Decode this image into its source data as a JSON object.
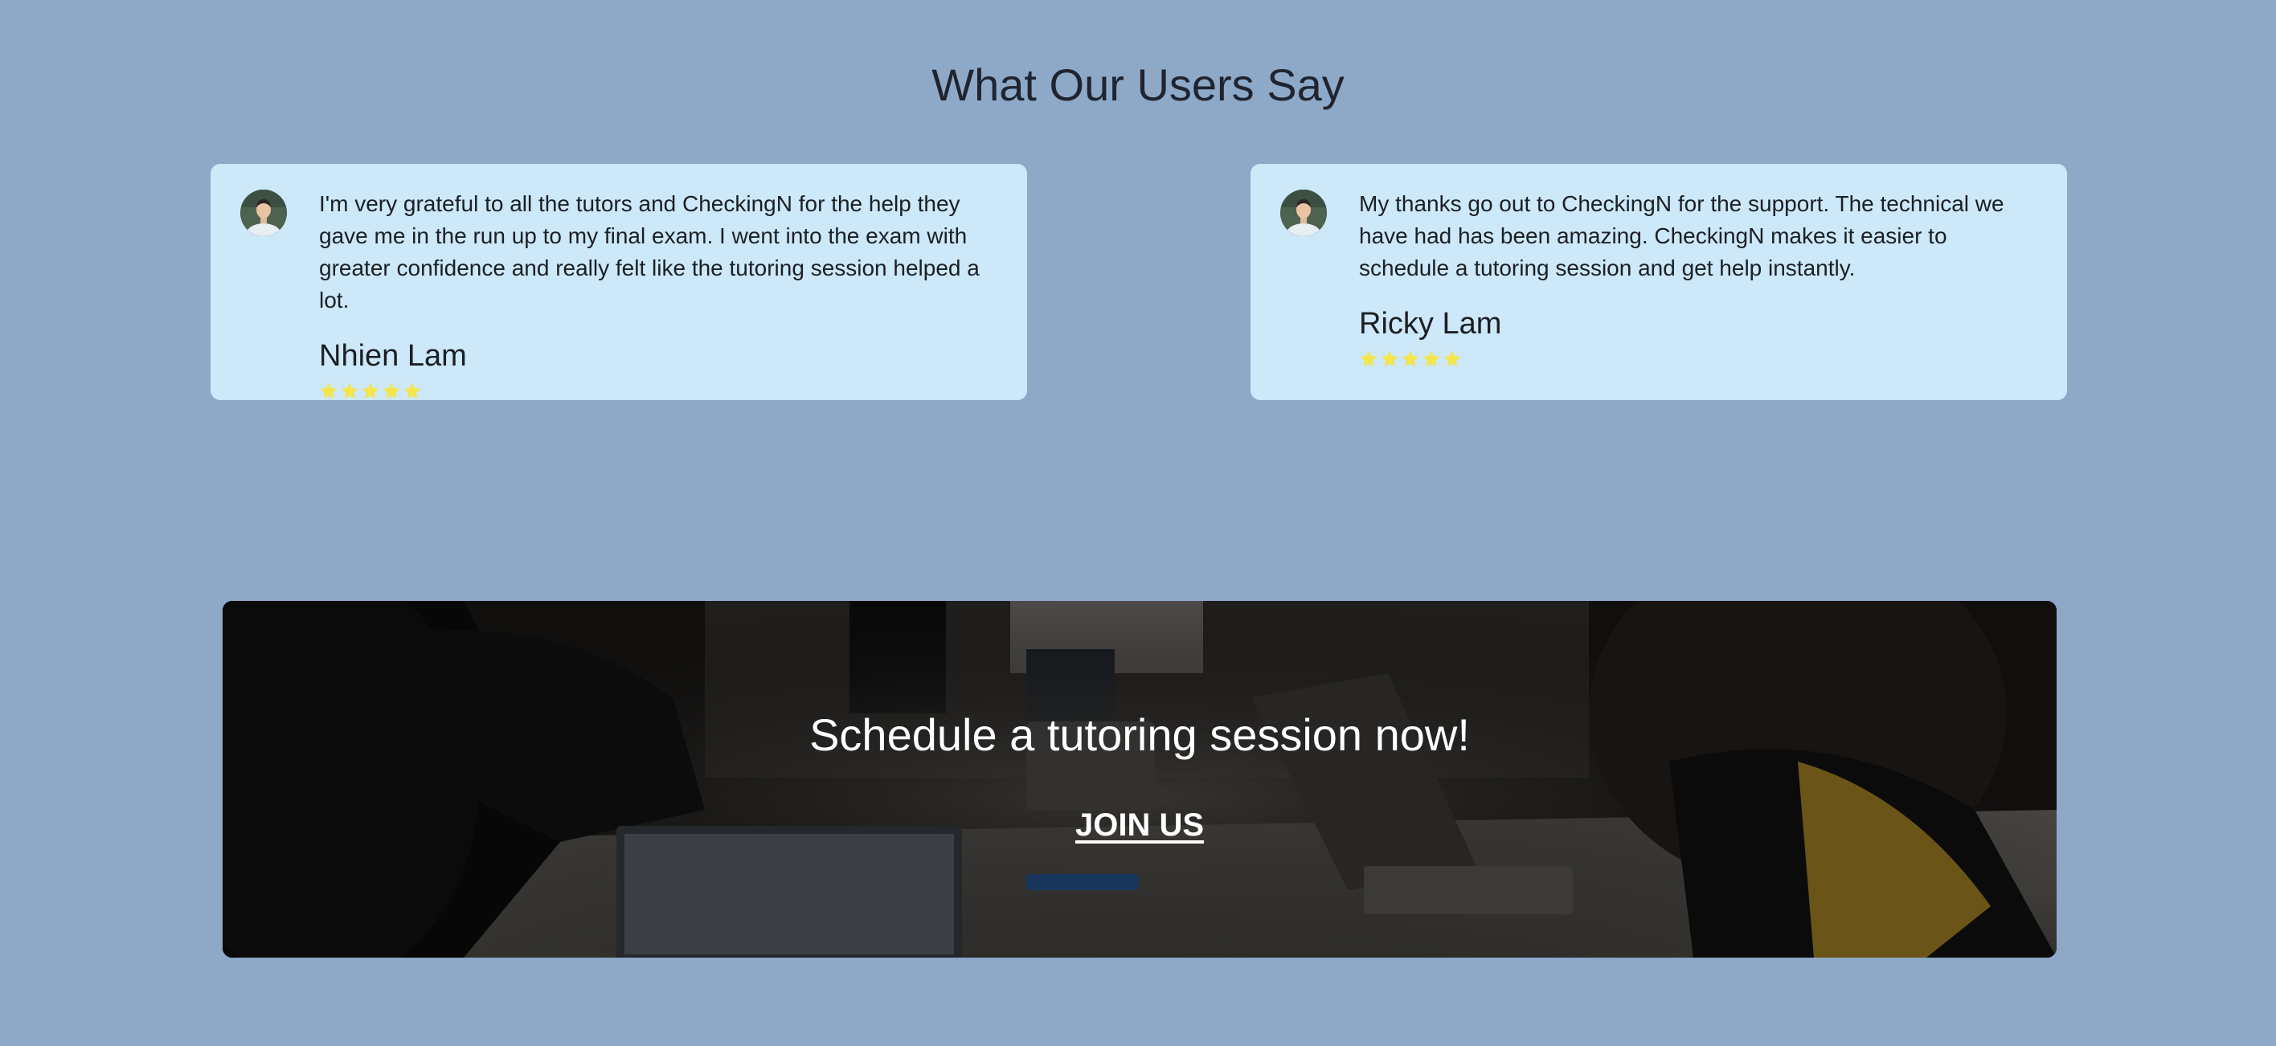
{
  "section": {
    "title": "What Our Users Say"
  },
  "testimonials": [
    {
      "quote": "I'm very grateful to all the tutors and CheckingN for the help they gave me in the run up to my final exam. I went into the exam with greater confidence and really felt like the tutoring session helped a lot.",
      "name": "Nhien Lam",
      "rating": 5
    },
    {
      "quote": "My thanks go out to CheckingN for the support. The technical we have had has been amazing. CheckingN makes it easier to schedule a tutoring session and get help instantly.",
      "name": "Ricky Lam",
      "rating": 5
    }
  ],
  "cta": {
    "title": "Schedule a tutoring session now!",
    "link_label": "JOIN US"
  },
  "colors": {
    "page_background": "#8ea9c8",
    "card_background": "#cce8f9",
    "star": "#f4e54a",
    "banner_text": "#ffffff"
  },
  "icons": {
    "avatar": "user-photo",
    "star": "star-icon"
  }
}
